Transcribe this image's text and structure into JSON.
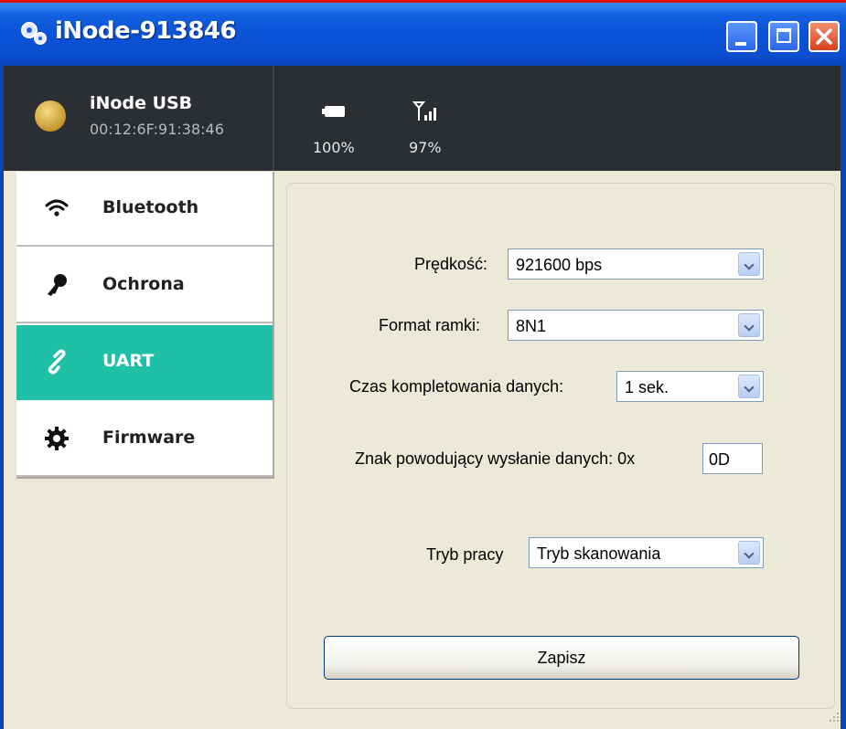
{
  "window": {
    "title": "iNode-913846"
  },
  "header": {
    "device_name": "iNode USB",
    "device_mac": "00:12:6F:91:38:46",
    "battery": "100%",
    "signal": "97%"
  },
  "sidebar": {
    "items": [
      {
        "label": "Bluetooth",
        "icon": "wifi-icon"
      },
      {
        "label": "Ochrona",
        "icon": "key-icon"
      },
      {
        "label": "UART",
        "icon": "link-icon",
        "active": true
      },
      {
        "label": "Firmware",
        "icon": "gear-icon"
      }
    ]
  },
  "form": {
    "speed_label": "Prędkość:",
    "speed_value": "921600 bps",
    "frame_label": "Format ramki:",
    "frame_value": "8N1",
    "time_label": "Czas kompletowania danych:",
    "time_value": "1 sek.",
    "char_label": "Znak powodujący wysłanie danych: 0x",
    "char_value": "0D",
    "mode_label": "Tryb pracy",
    "mode_value": "Tryb skanowania",
    "save_label": "Zapisz"
  },
  "colors": {
    "accent": "#20bfa8",
    "header_bg": "#2b2e33",
    "titlebar": "#0a52d6"
  }
}
